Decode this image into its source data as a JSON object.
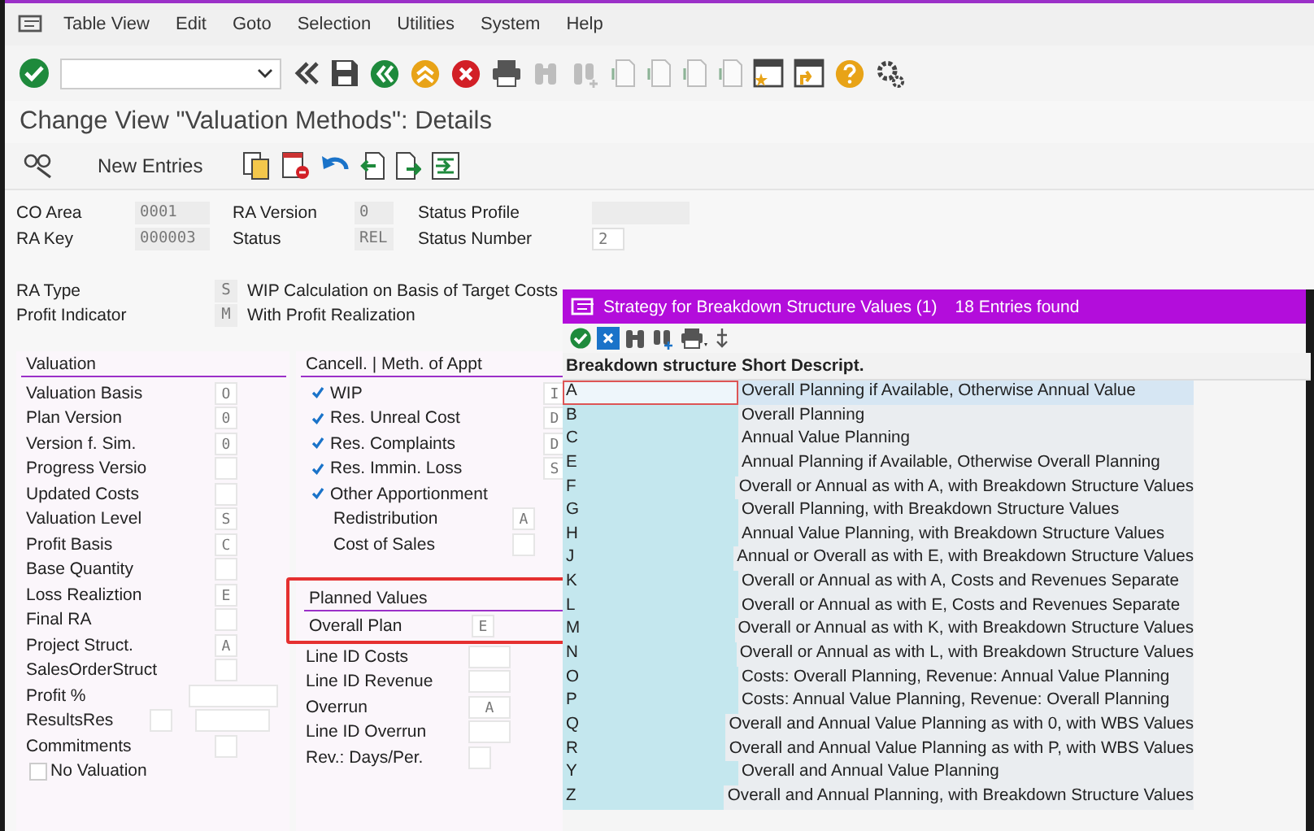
{
  "menu": [
    "Table View",
    "Edit",
    "Goto",
    "Selection",
    "Utilities",
    "System",
    "Help"
  ],
  "title": "Change View \"Valuation Methods\": Details",
  "app_toolbar": {
    "new_entries": "New Entries"
  },
  "header_fields": [
    {
      "label": "CO Area",
      "value": "0001",
      "editable": false
    },
    {
      "label": "RA Version",
      "value": "0",
      "editable": false
    },
    {
      "label": "Status Profile",
      "editable": false
    },
    {
      "label": "RA Key",
      "value": "000003",
      "editable": false
    },
    {
      "label": "Status",
      "value": "REL",
      "editable": false
    },
    {
      "label": "Status Number",
      "value": "2",
      "editable": true
    }
  ],
  "ra_fields": [
    {
      "label": "RA Type",
      "value": "S",
      "text": "WIP Calculation on Basis of Target Costs"
    },
    {
      "label": "Profit Indicator",
      "value": "M",
      "text": "With Profit Realization"
    }
  ],
  "valuation": {
    "title": "Valuation",
    "rows": [
      {
        "kind": "char",
        "label": "Valuation Basis",
        "value": "O"
      },
      {
        "kind": "char",
        "label": "Plan Version",
        "value": "0"
      },
      {
        "kind": "char",
        "label": "Version f. Sim.",
        "value": "0"
      },
      {
        "kind": "char",
        "label": "Progress Versio"
      },
      {
        "kind": "char",
        "label": "Updated Costs"
      },
      {
        "kind": "char",
        "label": "Valuation Level",
        "value": "S"
      },
      {
        "kind": "char",
        "label": "Profit Basis",
        "value": "C"
      },
      {
        "kind": "char",
        "label": "Base Quantity"
      },
      {
        "kind": "char",
        "label": "Loss Realiztion",
        "value": "E"
      },
      {
        "kind": "char",
        "label": "Final RA"
      },
      {
        "kind": "char",
        "label": "Project Struct.",
        "value": "A"
      },
      {
        "kind": "char",
        "label": "SalesOrderStruct"
      },
      {
        "kind": "wide",
        "label": "Profit %"
      },
      {
        "kind": "double",
        "label": "ResultsRes"
      },
      {
        "kind": "char",
        "label": "Commitments"
      },
      {
        "kind": "checkbox",
        "label": "No Valuation",
        "checked": false
      }
    ]
  },
  "cancellation": {
    "title": "Cancell. | Meth. of Appt",
    "rows": [
      {
        "label": "WIP",
        "checked": true,
        "value": "I"
      },
      {
        "label": "Res. Unreal Cost",
        "checked": true,
        "value": "D"
      },
      {
        "label": "Res. Complaints",
        "checked": true,
        "value": "D"
      },
      {
        "label": "Res. Immin. Loss",
        "checked": true,
        "value": "S"
      },
      {
        "label": "Other Apportionment",
        "checked": true,
        "children": [
          {
            "label": "Redistribution",
            "value": "A"
          },
          {
            "label": "Cost of Sales"
          }
        ]
      }
    ]
  },
  "planned_values": {
    "title": "Planned Values",
    "highlighted": true,
    "rows": [
      {
        "label": "Overall Plan",
        "value": "E",
        "highlighted": true
      },
      {
        "label": "Line ID Costs",
        "highlighted": false
      },
      {
        "label": "Line ID Revenue",
        "highlighted": false
      },
      {
        "label": "Overrun",
        "value": "A",
        "highlighted": false
      },
      {
        "label": "Line ID Overrun",
        "highlighted": false
      },
      {
        "label": "Rev.: Days/Per.",
        "kind": "small",
        "highlighted": false
      }
    ]
  },
  "popup": {
    "title": "Strategy for Breakdown Structure Values (1)",
    "count": "18 Entries found",
    "columns": [
      "Breakdown structure",
      "Short Descript."
    ],
    "rows": [
      {
        "key": "A",
        "text": "Overall Planning if Available, Otherwise Annual Value",
        "selected": true
      },
      {
        "key": "B",
        "text": "Overall Planning",
        "selected": false
      },
      {
        "key": "C",
        "text": "Annual Value Planning",
        "selected": false
      },
      {
        "key": "E",
        "text": "Annual Planning if Available, Otherwise Overall Planning",
        "selected": false
      },
      {
        "key": "F",
        "text": "Overall or Annual as with A, with Breakdown Structure Values",
        "selected": false
      },
      {
        "key": "G",
        "text": "Overall Planning, with Breakdown Structure Values",
        "selected": false
      },
      {
        "key": "H",
        "text": "Annual Value Planning, with Breakdown Structure Values",
        "selected": false
      },
      {
        "key": "J",
        "text": "Annual or Overall as with E, with Breakdown Structure Values",
        "selected": false
      },
      {
        "key": "K",
        "text": "Overall or Annual as with A, Costs and Revenues Separate",
        "selected": false
      },
      {
        "key": "L",
        "text": "Overall or Annual as with E, Costs and Revenues Separate",
        "selected": false
      },
      {
        "key": "M",
        "text": "Overall or Annual as with K, with Breakdown Structure Values",
        "selected": false
      },
      {
        "key": "N",
        "text": "Overall or Annual as with L, with Breakdown Structure Values",
        "selected": false
      },
      {
        "key": "O",
        "text": "Costs: Overall Planning, Revenue: Annual Value Planning",
        "selected": false
      },
      {
        "key": "P",
        "text": "Costs: Annual Value Planning, Revenue: Overall Planning",
        "selected": false
      },
      {
        "key": "Q",
        "text": "Overall and Annual Value Planning as with 0, with WBS Values",
        "selected": false
      },
      {
        "key": "R",
        "text": "Overall and Annual Value Planning as with P, with WBS Values",
        "selected": false
      },
      {
        "key": "Y",
        "text": "Overall and Annual Value Planning",
        "selected": false
      },
      {
        "key": "Z",
        "text": "Overall and Annual Planning, with Breakdown Structure Values",
        "selected": false
      }
    ]
  }
}
